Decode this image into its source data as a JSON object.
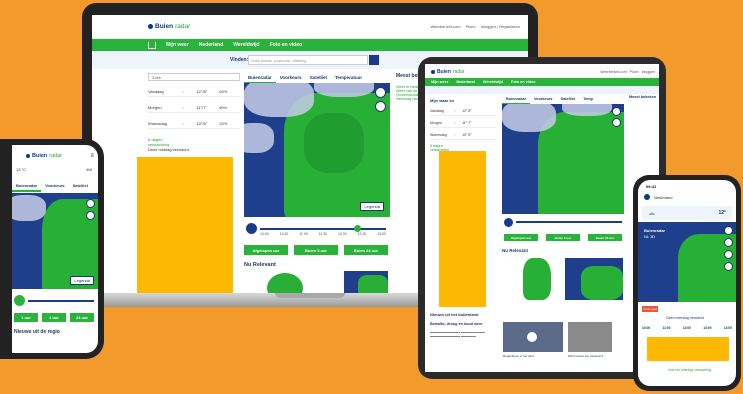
{
  "brand": {
    "name": "Buienradar",
    "logo_main": "Buien",
    "logo_sub": "radar"
  },
  "colors": {
    "background": "#f39a2c",
    "green": "#29b33b",
    "navy": "#1a3a8a",
    "highlight": "#fdb902"
  },
  "laptop": {
    "util_links": [
      "Weerbericht.com",
      "Pluim",
      "Inloggen / Registreren"
    ],
    "nav": [
      "Mijn weer",
      "Nederland",
      "Wereldwijd",
      "Foto en video"
    ],
    "search_label": "Vinden:",
    "search_placeholder": "Zoek plaats, postcode, afdeling",
    "side_search": "Zoek",
    "days": [
      {
        "day": "Vandaag",
        "temp": "12°/8°",
        "rain": "60%"
      },
      {
        "day": "Morgen",
        "temp": "11°/7°",
        "rain": "40%"
      },
      {
        "day": "Woensdag",
        "temp": "10°/6°",
        "rain": "20%"
      }
    ],
    "side_link": "8 dagen verwachting",
    "side_note": "Deze middag verwacht",
    "tabs": [
      "Buienradar",
      "Voorkeurs",
      "Satelliet",
      "Temperatuur"
    ],
    "legend": "Legenda",
    "times": [
      "10:00",
      "10:30",
      "11:00",
      "11:30",
      "12:00",
      "12:30",
      "13:00"
    ],
    "buttons": [
      "Afgelopen uur",
      "Buien 3 uur",
      "Buien 24 uur"
    ],
    "section": "Nu Relevant",
    "right_title": "Meest bekeken",
    "right_links": [
      "Weer in Nederland",
      "Weer van de wereld",
      "Onweersradar",
      "Neerslag radar"
    ]
  },
  "tablet": {
    "util_links": [
      "Weerbericht.com",
      "Pluim",
      "Inloggen"
    ],
    "nav": [
      "Mijn weer",
      "Nederland",
      "Wereldwijd",
      "Foto en video"
    ],
    "side_label": "Mijn waar kn",
    "days": [
      {
        "day": "Vandaag",
        "temp": "12° 8°"
      },
      {
        "day": "Morgen",
        "temp": "11° 7°"
      },
      {
        "day": "Woensdag",
        "temp": "10° 6°"
      }
    ],
    "side_link": "8 dagen verwachting",
    "tabs": [
      "Buienradar",
      "Voorkeurs",
      "Satelliet",
      "Temp"
    ],
    "right_title": "Meest bekeken",
    "buttons": [
      "Afgelopen uur",
      "Buien 3 uur",
      "Buien 24 uur"
    ],
    "section": "Nu Relevant",
    "news_header": "Nieuws uit het buitenland",
    "news_title": "Bewolkt, droog en koud weer",
    "news_items": [
      "Regenbuien in het land",
      "Wind neemt toe vanavond"
    ]
  },
  "phone_left": {
    "temp": "13 °C",
    "wind": "4W",
    "tabs": [
      "Buienradar",
      "Voorkeurs",
      "Satelliet"
    ],
    "legend": "Legenda",
    "buttons": [
      "1 uur",
      "3 uur",
      "24 uur"
    ],
    "footer": "Nieuws uit de regio"
  },
  "phone_right": {
    "time": "09:41",
    "location": "Nederland",
    "temp_big": "12°",
    "card_title": "Buienradar",
    "card_sub": "NL 3D",
    "warn": "Code geel",
    "times": [
      "10:00",
      "11:00",
      "12:00",
      "13:00",
      "14:00"
    ],
    "note": "Geen neerslag verwacht",
    "link": "Voor het volledige verwachting"
  }
}
